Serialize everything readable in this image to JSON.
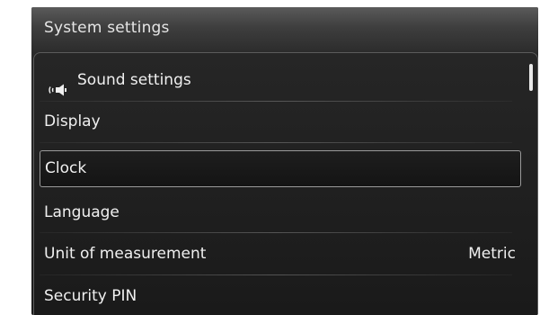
{
  "header": {
    "title": "System settings"
  },
  "menu": {
    "items": [
      {
        "label": "Sound settings",
        "icon": "speaker-icon",
        "value": ""
      },
      {
        "label": "Display",
        "value": ""
      },
      {
        "label": "Clock",
        "value": "",
        "selected": true
      },
      {
        "label": "Language",
        "value": ""
      },
      {
        "label": "Unit of measurement",
        "value": "Metric"
      },
      {
        "label": "Security PIN",
        "value": ""
      }
    ]
  },
  "colors": {
    "text": "#f0f0f0",
    "title_text": "#e6e6e6",
    "background": "#1c1c1c",
    "selection_border": "#9a9a9a",
    "scroll_thumb": "#e8e8e8"
  }
}
